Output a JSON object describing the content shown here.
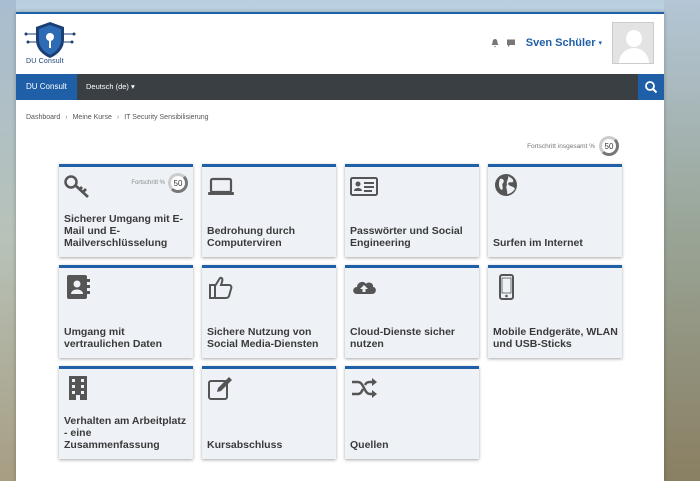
{
  "header": {
    "logo_text": "DU Consult",
    "user_name": "Sven Schüler"
  },
  "navbar": {
    "brand": "DU Consult",
    "language": "Deutsch (de)"
  },
  "breadcrumb": [
    "Dashboard",
    "Meine Kurse",
    "IT Security Sensibilisierung"
  ],
  "overall_progress": {
    "label": "Fortschritt insgesamt %",
    "value": "50"
  },
  "tiles": [
    {
      "title": "Sicherer Umgang mit E-Mail und E-Mailverschlüsselung",
      "icon": "key-icon",
      "progress_label": "Fortschritt %",
      "progress_value": "50"
    },
    {
      "title": "Bedrohung durch Computerviren",
      "icon": "laptop-icon"
    },
    {
      "title": "Passwörter und Social Engineering",
      "icon": "id-card-icon"
    },
    {
      "title": "Surfen im Internet",
      "icon": "globe-icon"
    },
    {
      "title": "Umgang mit vertraulichen Daten",
      "icon": "address-book-icon"
    },
    {
      "title": "Sichere Nutzung von Social Media-Diensten",
      "icon": "thumbs-up-icon"
    },
    {
      "title": "Cloud-Dienste sicher nutzen",
      "icon": "cloud-upload-icon"
    },
    {
      "title": "Mobile Endgeräte, WLAN und USB-Sticks",
      "icon": "mobile-icon"
    },
    {
      "title": "Verhalten am Arbeitplatz - eine Zusammenfassung",
      "icon": "building-icon"
    },
    {
      "title": "Kursabschluss",
      "icon": "edit-icon"
    },
    {
      "title": "Quellen",
      "icon": "shuffle-icon"
    }
  ]
}
